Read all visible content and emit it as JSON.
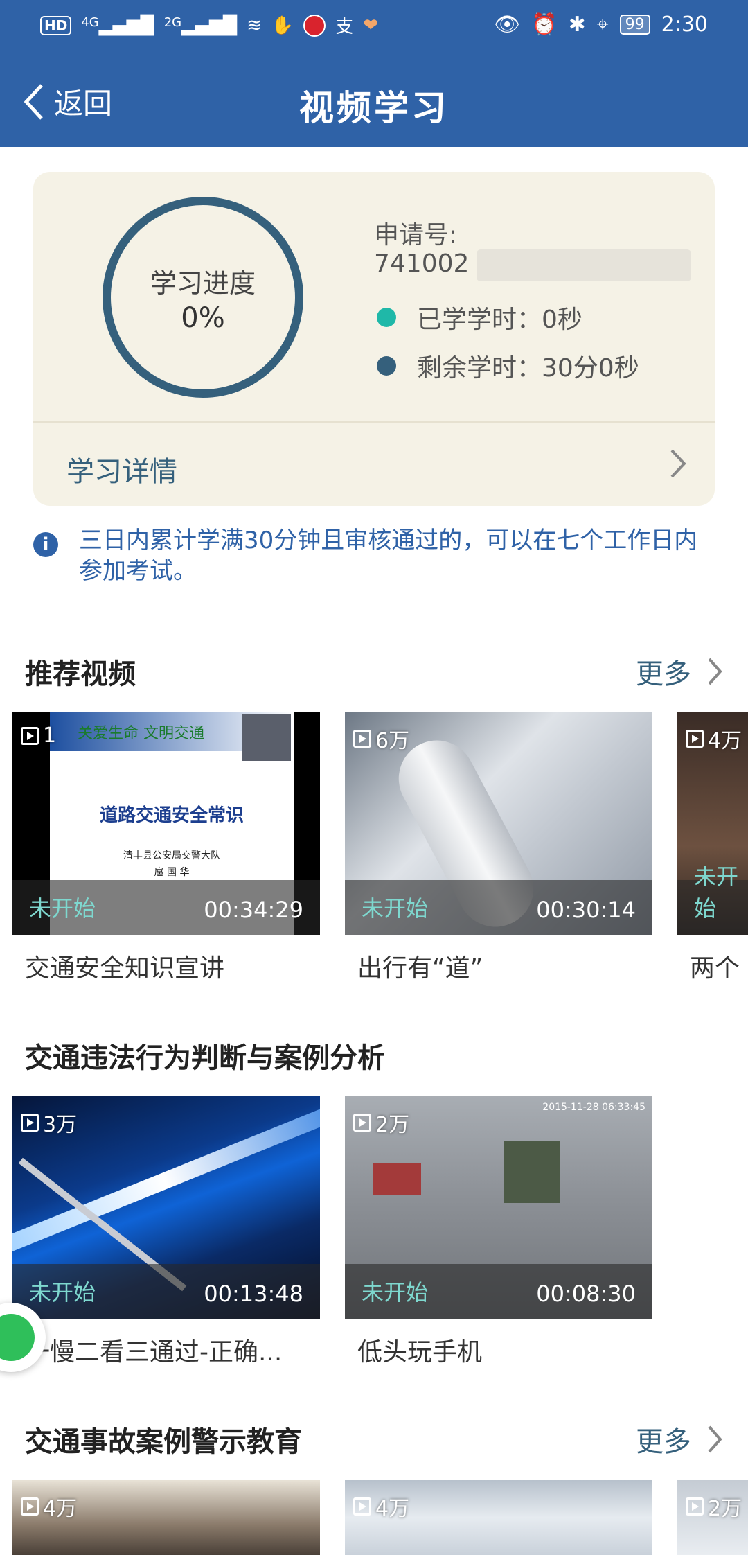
{
  "status_bar": {
    "left_items": [
      "HD",
      "4G",
      "2G"
    ],
    "battery": "99",
    "time": "2:30"
  },
  "nav": {
    "back_label": "返回",
    "title": "视频学习"
  },
  "progress_card": {
    "ring_label": "学习进度",
    "ring_value": "0%",
    "application_label": "申请号:",
    "application_number": "741002",
    "studied_label": "已学学时：0秒",
    "remaining_label": "剩余学时：30分0秒",
    "detail_label": "学习详情",
    "colors": {
      "studied": "#1fb8a8",
      "remaining": "#35607c"
    }
  },
  "notice": {
    "icon": "i",
    "text": "三日内累计学满30分钟且审核通过的，可以在七个工作日内参加考试。"
  },
  "sections": [
    {
      "title": "推荐视频",
      "more_label": "更多",
      "videos": [
        {
          "views": "1",
          "status": "未开始",
          "duration": "00:34:29",
          "title": "交通安全知识宣讲",
          "slide_header": "关爱生命   文明交通",
          "slide_title": "道路交通安全常识",
          "slide_org": "清丰县公安局交警大队",
          "slide_name": "扈 国 华"
        },
        {
          "views": "6万",
          "status": "未开始",
          "duration": "00:30:14",
          "title": "出行有“道”"
        },
        {
          "views": "4万",
          "status": "未开始",
          "title": "两个"
        }
      ]
    },
    {
      "title": "交通违法行为判断与案例分析",
      "videos": [
        {
          "views": "3万",
          "status": "未开始",
          "duration": "00:13:48",
          "title": "一慢二看三通过-正确..."
        },
        {
          "views": "2万",
          "status": "未开始",
          "duration": "00:08:30",
          "title": "低头玩手机",
          "stamp": "2015-11-28 06:33:45"
        }
      ]
    },
    {
      "title": "交通事故案例警示教育",
      "more_label": "更多",
      "videos": [
        {
          "views": "4万"
        },
        {
          "views": "4万"
        },
        {
          "views": "2万"
        }
      ]
    }
  ]
}
